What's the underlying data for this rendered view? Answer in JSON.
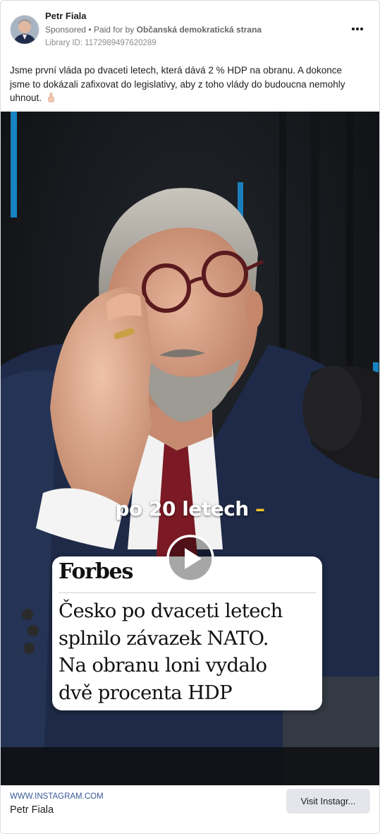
{
  "post": {
    "page_name": "Petr Fiala",
    "sponsored_label": "Sponsored",
    "paid_for_prefix": "Paid for by",
    "paid_for_by": "Občanská demokratická strana",
    "library_id": "Library ID: 1172989497620289",
    "more_icon": "more-horizontal-icon",
    "text": "Jsme první vláda po dvaceti letech, která dává 2 % HDP na obranu. A dokonce jsme to dokázali zafixovat do legislativy, aby z toho vlády do budoucna nemohly uhnout.",
    "emoji": "pointing-up-emoji"
  },
  "video": {
    "caption_main": "po 20 letech",
    "caption_dash": "–",
    "play_icon": "play-icon",
    "news": {
      "brand": "Forbes",
      "headline_lines": [
        "Česko po dvaceti letech",
        "splnilo závazek NATO.",
        "Na obranu loni vydalo",
        "dvě procenta HDP"
      ]
    }
  },
  "footer": {
    "domain": "WWW.INSTAGRAM.COM",
    "title": "Petr Fiala",
    "cta_label": "Visit Instagr..."
  },
  "colors": {
    "link_blue": "#385898",
    "secondary_text": "#65676b",
    "cta_background": "#e4e6eb",
    "caption_accent": "#f2c230"
  }
}
